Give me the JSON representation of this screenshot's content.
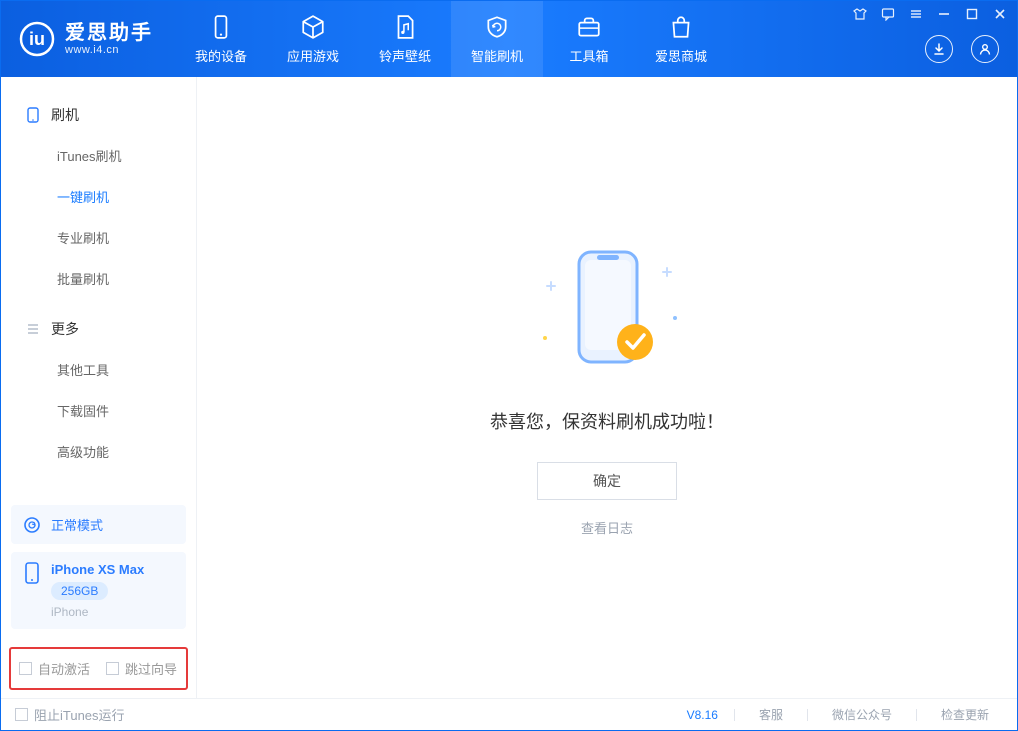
{
  "app": {
    "name_cn": "爱思助手",
    "name_en": "www.i4.cn"
  },
  "nav": {
    "items": [
      {
        "label": "我的设备"
      },
      {
        "label": "应用游戏"
      },
      {
        "label": "铃声壁纸"
      },
      {
        "label": "智能刷机"
      },
      {
        "label": "工具箱"
      },
      {
        "label": "爱思商城"
      }
    ]
  },
  "sidebar": {
    "section_flash": "刷机",
    "section_more": "更多",
    "flash_items": [
      {
        "label": "iTunes刷机"
      },
      {
        "label": "一键刷机"
      },
      {
        "label": "专业刷机"
      },
      {
        "label": "批量刷机"
      }
    ],
    "more_items": [
      {
        "label": "其他工具"
      },
      {
        "label": "下载固件"
      },
      {
        "label": "高级功能"
      }
    ],
    "mode_label": "正常模式",
    "device_name": "iPhone XS Max",
    "device_storage": "256GB",
    "device_type": "iPhone",
    "auto_activate": "自动激活",
    "skip_guide": "跳过向导"
  },
  "main": {
    "success_message": "恭喜您，保资料刷机成功啦！",
    "ok_button": "确定",
    "view_log": "查看日志"
  },
  "footer": {
    "block_itunes": "阻止iTunes运行",
    "version": "V8.16",
    "customer_service": "客服",
    "wechat": "微信公众号",
    "check_update": "检查更新"
  }
}
